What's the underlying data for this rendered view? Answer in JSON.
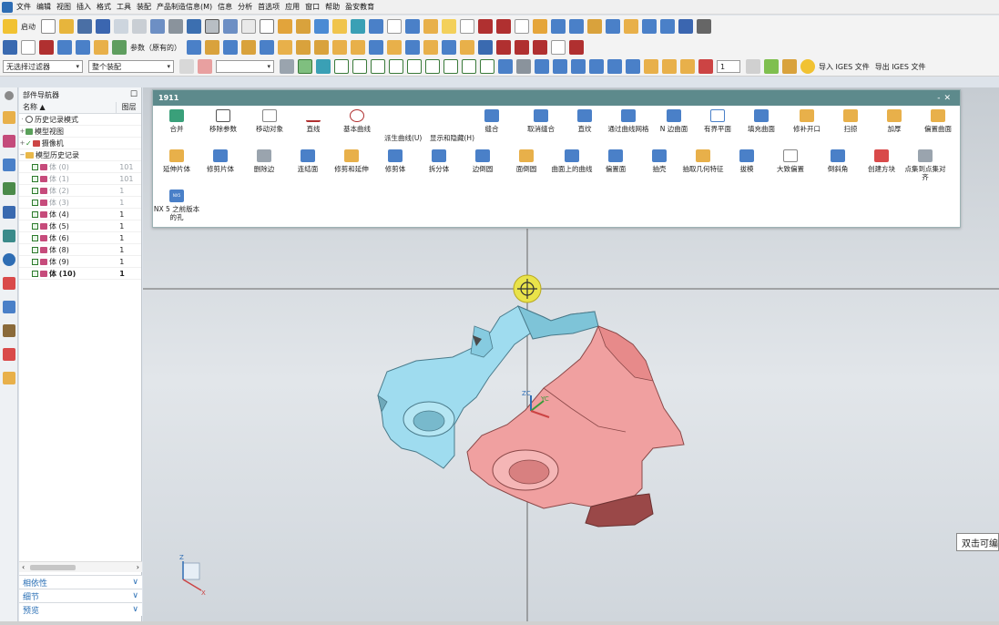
{
  "menubar": {
    "items": [
      "文件",
      "编辑",
      "视图",
      "插入",
      "格式",
      "工具",
      "装配",
      "产品制造信息(M)",
      "信息",
      "分析",
      "首选项",
      "应用",
      "窗口",
      "帮助",
      "盈安教育"
    ]
  },
  "toolbar1": {
    "start_label": "启动"
  },
  "toolbar2": {
    "param_label": "参数（原有的）"
  },
  "toolbar3": {
    "filter_select": "无选择过滤器",
    "assembly_select": "整个装配",
    "layer_value": "1",
    "import_iges": "导入 IGES 文件",
    "export_iges": "导出 IGES 文件"
  },
  "navigator": {
    "title": "部件导航器",
    "col_name": "名称",
    "col_layer": "图层",
    "rows": [
      {
        "label": "历史记录模式",
        "layer": ""
      },
      {
        "label": "模型视图",
        "layer": ""
      },
      {
        "label": "摄像机",
        "layer": ""
      },
      {
        "label": "模型历史记录",
        "layer": ""
      },
      {
        "label": "体 (0)",
        "layer": "101"
      },
      {
        "label": "体 (1)",
        "layer": "101"
      },
      {
        "label": "体 (2)",
        "layer": "1"
      },
      {
        "label": "体 (3)",
        "layer": "1"
      },
      {
        "label": "体 (4)",
        "layer": "1"
      },
      {
        "label": "体 (5)",
        "layer": "1"
      },
      {
        "label": "体 (6)",
        "layer": "1"
      },
      {
        "label": "体 (8)",
        "layer": "1"
      },
      {
        "label": "体 (9)",
        "layer": "1"
      },
      {
        "label": "体 (10)",
        "layer": "1"
      }
    ],
    "sections": [
      "相依性",
      "细节",
      "预览"
    ]
  },
  "cmdpanel": {
    "title": "1911",
    "row1": [
      "合并",
      "移除参数",
      "移动对象",
      "直线",
      "基本曲线",
      "缝合",
      "取消缝合",
      "直纹",
      "通过曲线网格",
      "N 边曲面",
      "有界平面",
      "填充曲面",
      "修补开口",
      "扫掠",
      "加厚",
      "偏置曲面"
    ],
    "text_menus": [
      "派生曲线(U)",
      "显示和隐藏(H)"
    ],
    "row2": [
      "延伸片体",
      "修剪片体",
      "删除边",
      "连结面",
      "修剪和延伸",
      "修剪体",
      "拆分体",
      "边倒圆",
      "面倒圆",
      "曲面上的曲线",
      "偏置面",
      "抽壳",
      "抽取几何特征",
      "拔模",
      "大致偏置",
      "倒斜角",
      "创建方块",
      "点集到点集对齐"
    ],
    "row3": [
      "NX 5 之前版本的孔"
    ],
    "icon_label": "NX5"
  },
  "viewport": {
    "triad_axes": [
      "ZC",
      "YC",
      "XC"
    ],
    "corner_axes": [
      "Z",
      "X"
    ]
  },
  "tooltip": {
    "text": "双击可编"
  },
  "colors": {
    "panel_title": "#5d8a8c",
    "part_cyan": "#9fdcef",
    "part_red": "#f0a0a0",
    "nav_section": "#2a6fb5"
  }
}
